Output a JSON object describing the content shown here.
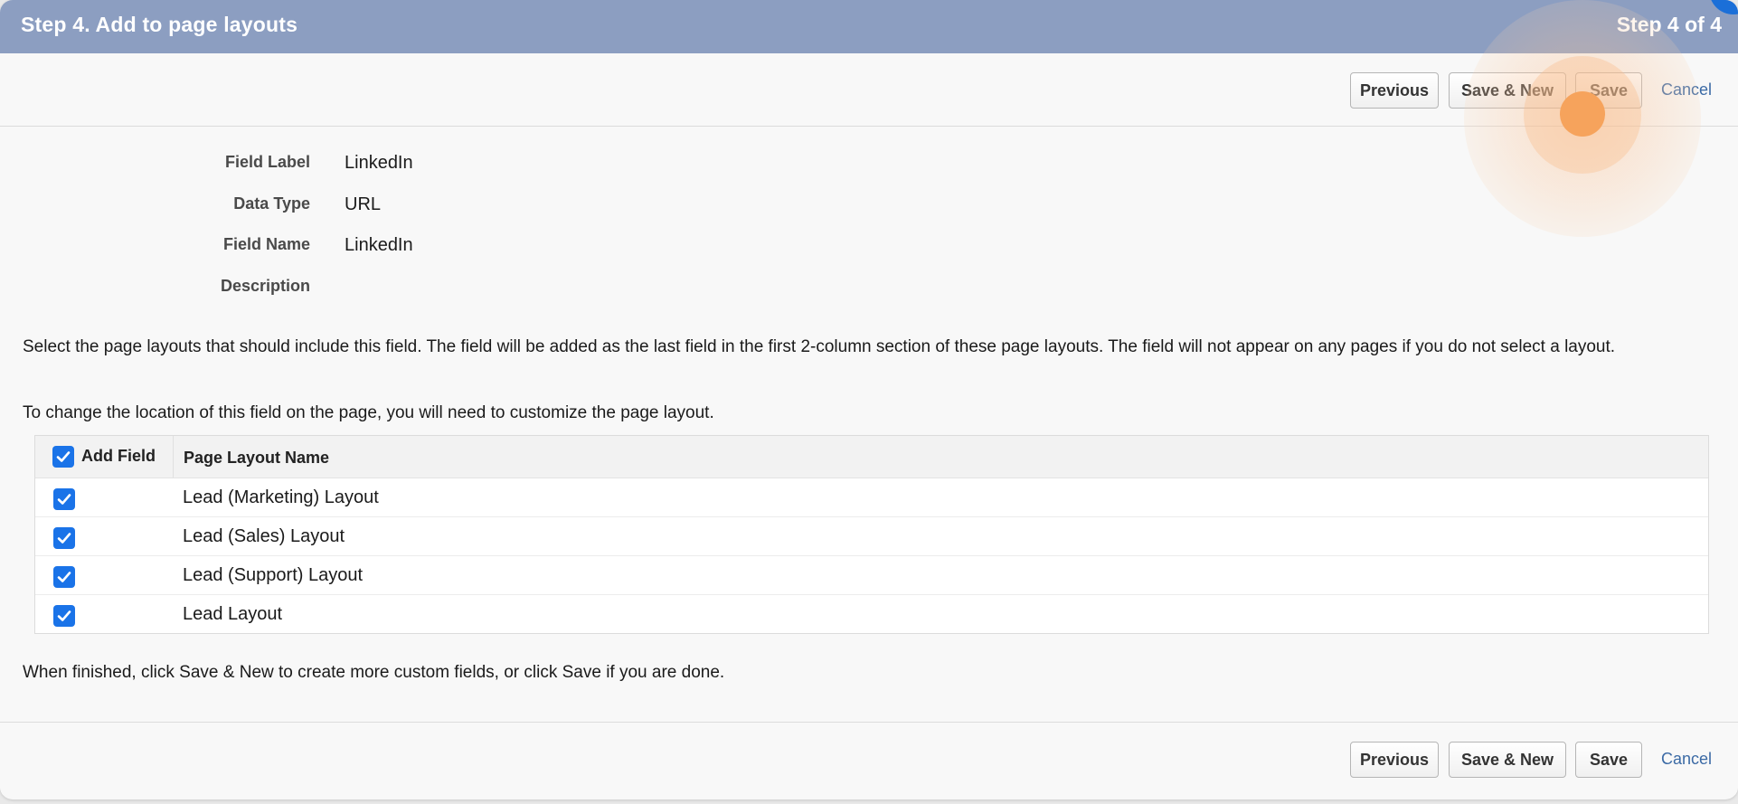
{
  "header": {
    "title": "Step 4. Add to page layouts",
    "step": "Step 4 of 4"
  },
  "buttons": {
    "previous": "Previous",
    "save_new": "Save & New",
    "save": "Save",
    "cancel": "Cancel"
  },
  "details": [
    {
      "label": "Field Label",
      "value": "LinkedIn"
    },
    {
      "label": "Data Type",
      "value": "URL"
    },
    {
      "label": "Field Name",
      "value": "LinkedIn"
    },
    {
      "label": "Description",
      "value": ""
    }
  ],
  "instructions": {
    "select_text": "Select the page layouts that should include this field. The field will be added as the last field in the first 2-column section of these page layouts. The field will not appear on any pages if you do not select a layout.",
    "location_text": "To change the location of this field on the page, you will need to customize the page layout.",
    "finished_text": "When finished, click Save & New to create more custom fields, or click Save if you are done."
  },
  "layout_table": {
    "headers": {
      "add_field": "Add Field",
      "page_layout_name": "Page Layout Name"
    },
    "select_all_checked": true,
    "rows": [
      {
        "name": "Lead (Marketing) Layout",
        "checked": true
      },
      {
        "name": "Lead (Sales) Layout",
        "checked": true
      },
      {
        "name": "Lead (Support) Layout",
        "checked": true
      },
      {
        "name": "Lead Layout",
        "checked": true
      }
    ]
  },
  "colors": {
    "header_bg": "#8c9ec1",
    "checkbox": "#1a73e8",
    "link": "#3b6aa5",
    "cursor_highlight": "#f6a35c"
  }
}
